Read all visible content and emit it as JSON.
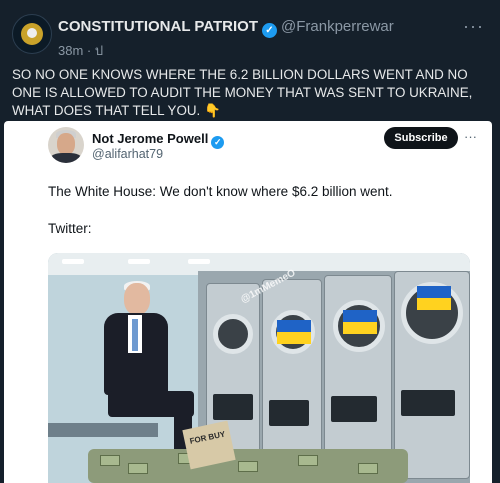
{
  "tweet": {
    "author_name": "CONSTITUTIONAL PATRIOT",
    "handle": "@Frankperrewar",
    "time": "38m · ป",
    "text": "SO NO ONE KNOWS WHERE THE 6.2 BILLION DOLLARS WENT AND NO ONE IS ALLOWED TO AUDIT THE MONEY THAT WAS SENT TO UKRAINE, WHAT DOES THAT TELL YOU. 👇",
    "more": "···"
  },
  "quoted": {
    "author_name": "Not Jerome Powell",
    "handle": "@alifarhat79",
    "subscribe_label": "Subscribe",
    "more": "···",
    "line1": "The White House: We don't know where $6.2 billion went.",
    "line2": "Twitter:",
    "image_watermark": "@1mMemeO",
    "sign_text": "FOR BUY"
  },
  "colors": {
    "background": "#15202b",
    "card": "#ffffff",
    "verified": "#1d9bf0",
    "ukraine_blue": "#1f63c6",
    "ukraine_yellow": "#ffd21f"
  },
  "icons": [
    "verified-badge-icon",
    "more-icon"
  ]
}
